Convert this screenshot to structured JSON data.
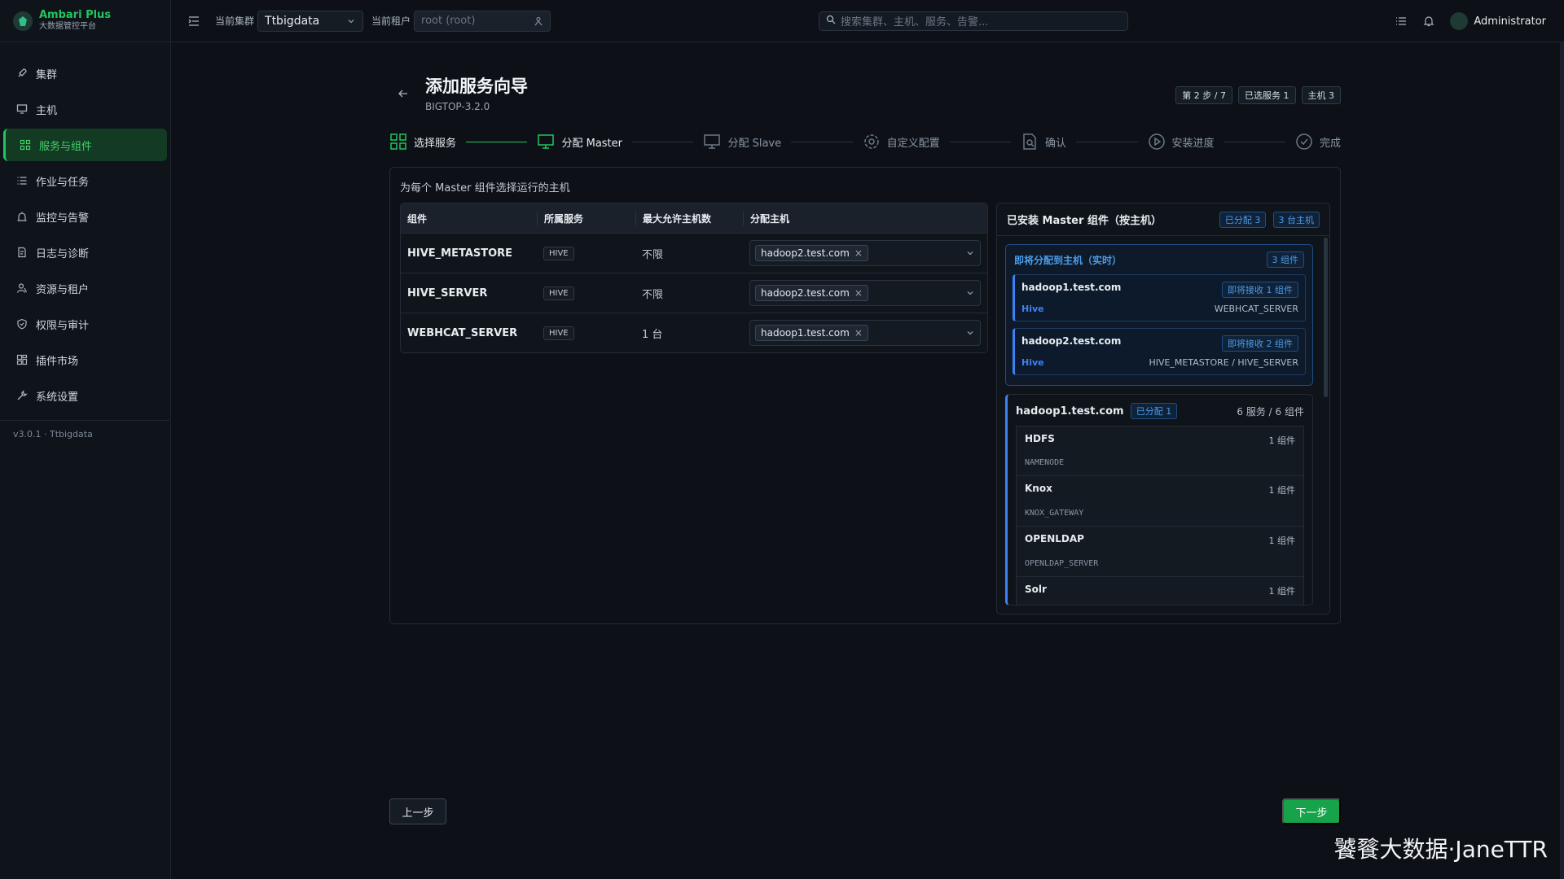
{
  "brand": {
    "name": "Ambari Plus",
    "subtitle": "大数据管控平台"
  },
  "sidebar": {
    "items": [
      {
        "label": "集群",
        "icon": "rocket-icon"
      },
      {
        "label": "主机",
        "icon": "monitor-icon"
      },
      {
        "label": "服务与组件",
        "icon": "grid-icon",
        "active": true
      },
      {
        "label": "作业与任务",
        "icon": "list-icon"
      },
      {
        "label": "监控与告警",
        "icon": "alarm-icon"
      },
      {
        "label": "日志与诊断",
        "icon": "log-icon"
      },
      {
        "label": "资源与租户",
        "icon": "user-icon"
      },
      {
        "label": "权限与审计",
        "icon": "shield-icon"
      },
      {
        "label": "插件市场",
        "icon": "plugin-icon"
      },
      {
        "label": "系统设置",
        "icon": "wrench-icon"
      }
    ],
    "version": "v3.0.1 · Ttbigdata"
  },
  "topbar": {
    "cluster_label": "当前集群",
    "cluster_value": "Ttbigdata",
    "tenant_label": "当前租户",
    "tenant_value": "root (root)",
    "search_placeholder": "搜索集群、主机、服务、告警...",
    "user": "Administrator"
  },
  "wizard": {
    "title": "添加服务向导",
    "stack": "BIGTOP-3.2.0",
    "badges": [
      "第 2 步 / 7",
      "已选服务 1",
      "主机 3"
    ],
    "steps": [
      {
        "label": "选择服务",
        "state": "done"
      },
      {
        "label": "分配 Master",
        "state": "current"
      },
      {
        "label": "分配 Slave",
        "state": "todo"
      },
      {
        "label": "自定义配置",
        "state": "todo"
      },
      {
        "label": "确认",
        "state": "todo"
      },
      {
        "label": "安装进度",
        "state": "todo"
      },
      {
        "label": "完成",
        "state": "todo"
      }
    ],
    "hint": "为每个 Master 组件选择运行的主机",
    "table": {
      "headers": [
        "组件",
        "所属服务",
        "最大允许主机数",
        "分配主机"
      ],
      "rows": [
        {
          "component": "HIVE_METASTORE",
          "service": "HIVE",
          "max": "不限",
          "host": "hadoop2.test.com"
        },
        {
          "component": "HIVE_SERVER",
          "service": "HIVE",
          "max": "不限",
          "host": "hadoop2.test.com"
        },
        {
          "component": "WEBHCAT_SERVER",
          "service": "HIVE",
          "max": "1 台",
          "host": "hadoop1.test.com"
        }
      ]
    },
    "installed": {
      "title": "已安装 Master 组件（按主机）",
      "assigned_badge": "已分配 3",
      "hosts_badge": "3 台主机",
      "preview_title": "即将分配到主机（实时）",
      "preview_count": "3 组件",
      "preview_cards": [
        {
          "host": "hadoop1.test.com",
          "receive": "即将接收 1 组件",
          "service": "Hive",
          "components": "WEBHCAT_SERVER"
        },
        {
          "host": "hadoop2.test.com",
          "receive": "即将接收 2 组件",
          "service": "Hive",
          "components": "HIVE_METASTORE / HIVE_SERVER"
        }
      ],
      "host_block": {
        "host": "hadoop1.test.com",
        "tag": "已分配 1",
        "summary": "6 服务 / 6 组件",
        "services": [
          {
            "name": "HDFS",
            "count": "1 组件",
            "component": "NAMENODE"
          },
          {
            "name": "Knox",
            "count": "1 组件",
            "component": "KNOX_GATEWAY"
          },
          {
            "name": "OPENLDAP",
            "count": "1 组件",
            "component": "OPENLDAP_SERVER"
          },
          {
            "name": "Solr",
            "count": "1 组件",
            "component": ""
          }
        ]
      }
    },
    "prev_label": "上一步",
    "next_label": "下一步"
  },
  "watermark": "饕餮大数据·JaneTTR",
  "colors": {
    "accent": "#22c55e",
    "info": "#3b82f6",
    "background": "#0d1117"
  }
}
